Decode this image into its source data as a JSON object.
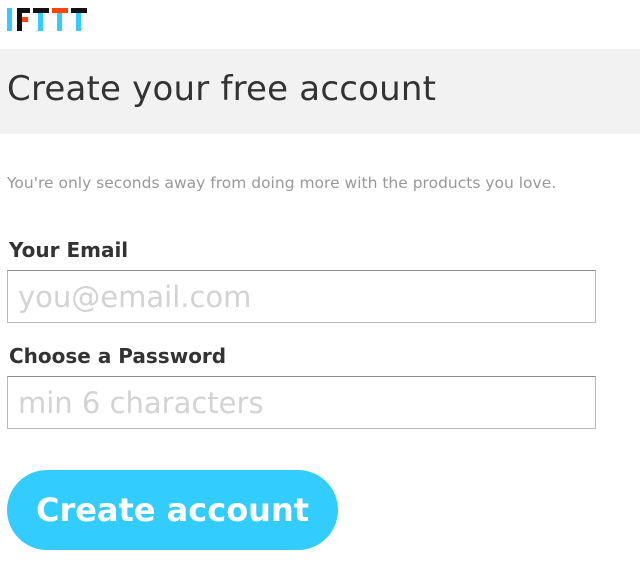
{
  "brand": {
    "logo_text": "IFTTT",
    "colors": {
      "accent": "#33ccff",
      "dark": "#111111",
      "orange": "#ff4400",
      "header_band": "#f2f2f2"
    }
  },
  "header": {
    "title": "Create your free account"
  },
  "main": {
    "subtitle": "You're only seconds away from doing more with the products you love.",
    "email_field": {
      "label": "Your Email",
      "placeholder": "you@email.com",
      "value": ""
    },
    "password_field": {
      "label": "Choose a Password",
      "placeholder": "min 6 characters",
      "value": ""
    },
    "submit_label": "Create account"
  }
}
